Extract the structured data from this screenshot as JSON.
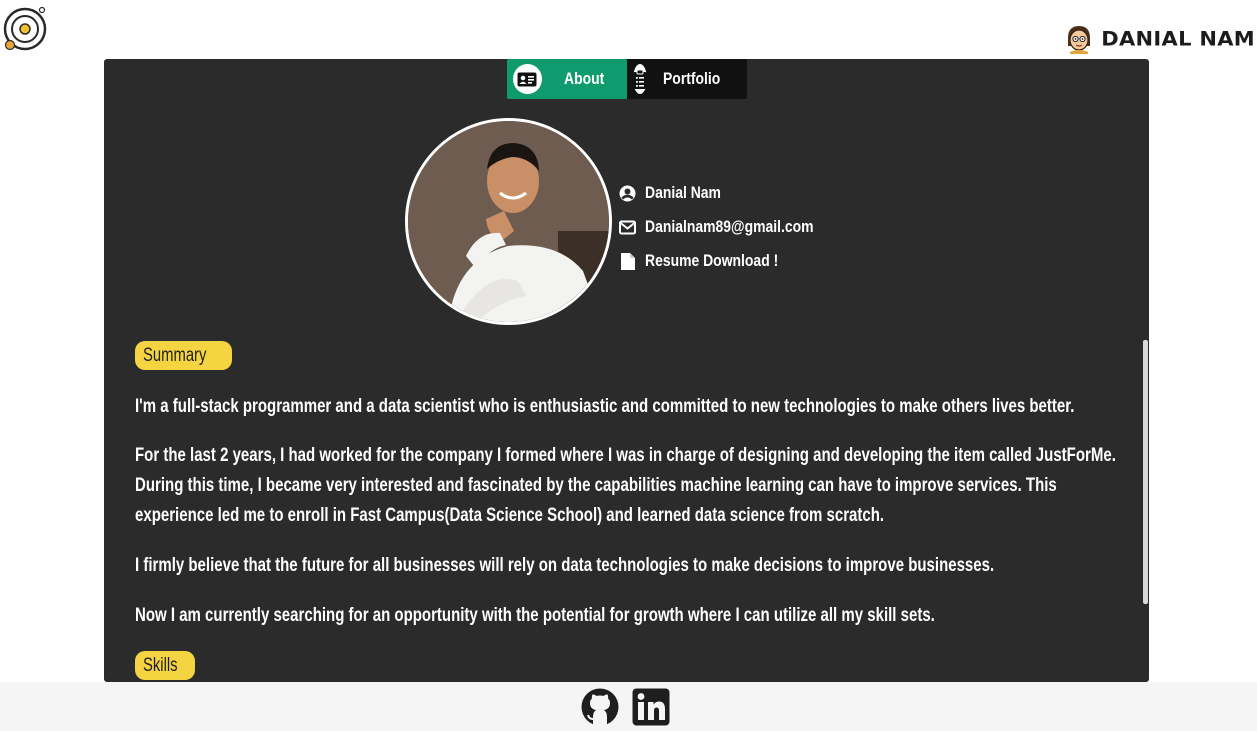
{
  "header": {
    "brand_name": "DANIAL NAM",
    "logo_icon": "planet-ring-logo-icon",
    "brand_icon": "cartoon-face-icon"
  },
  "tabs": [
    {
      "label": "About",
      "icon": "id-card-icon",
      "active": true
    },
    {
      "label": "Portfolio",
      "icon": "clipboard-list-icon",
      "active": false
    }
  ],
  "profile": {
    "name": "Danial Nam",
    "email": "Danialnam89@gmail.com",
    "resume": "Resume Download !"
  },
  "sections": {
    "summary_label": "Summary",
    "skills_label": "Skills"
  },
  "summary": {
    "p1": "I'm a full-stack programmer and a data scientist who is enthusiastic and committed to new technologies to make others lives better.",
    "p2": "For the last 2 years, I had worked for the company I formed where I was in charge of designing and developing the item called JustForMe. During this time, I became very interested and fascinated by the capabilities machine learning can have to improve services. This experience led me to enroll in Fast Campus(Data Science School) and learned data science from scratch.",
    "p3": "I firmly believe that the future for all businesses will rely on data technologies to make decisions to improve businesses.",
    "p4": "Now I am currently searching for an opportunity with the potential for growth where I can utilize all my skill sets."
  },
  "footer": {
    "icons": [
      "github-icon",
      "linkedin-icon"
    ]
  },
  "colors": {
    "card_bg": "#2b2b2b",
    "tab_active": "#0f9b6d",
    "tab_inactive": "#111111",
    "badge": "#f5d442",
    "footer_bg": "#f5f5f5"
  }
}
